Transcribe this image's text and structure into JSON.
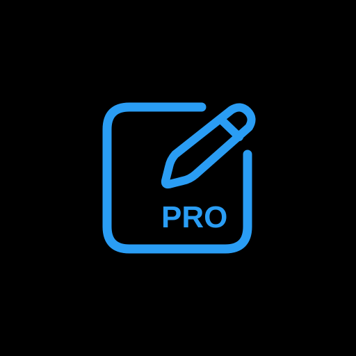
{
  "app_icon": {
    "icon_name": "edit-pencil-square-icon",
    "badge_label": "PRO",
    "colors": {
      "background": "#000000",
      "accent": "#2A9DF4"
    }
  }
}
